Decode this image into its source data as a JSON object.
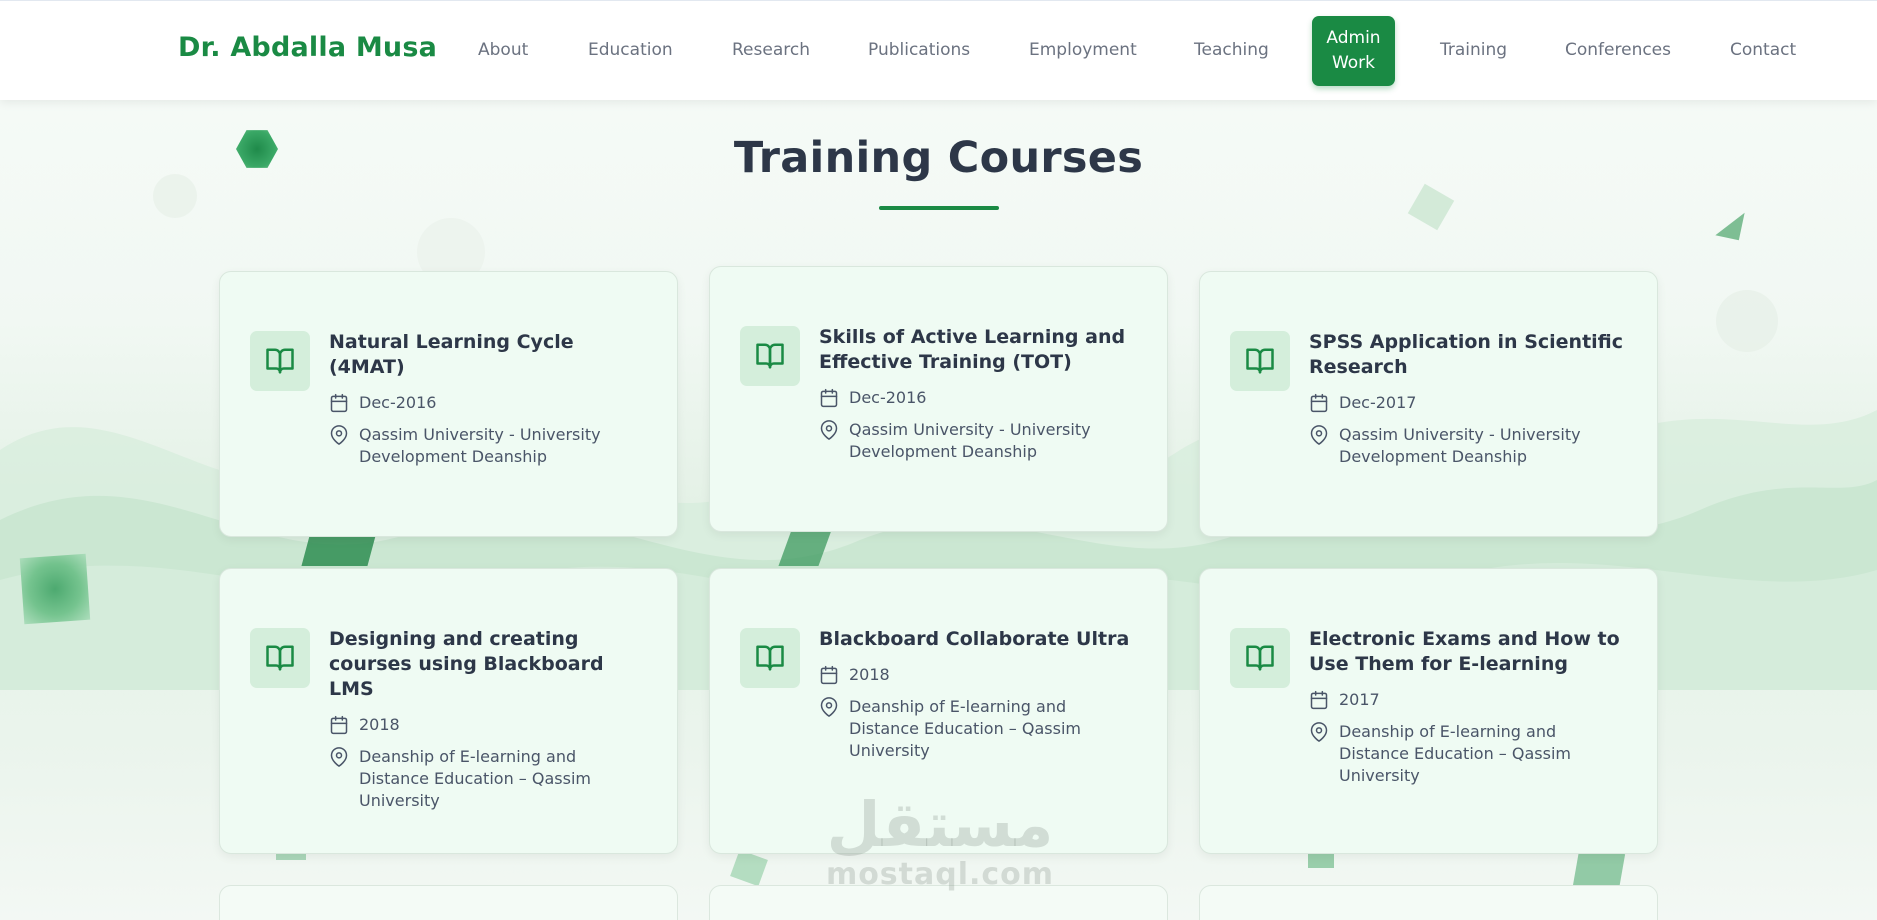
{
  "nav": {
    "brand": "Dr. Abdalla Musa",
    "links": [
      {
        "label": "About"
      },
      {
        "label": "Education"
      },
      {
        "label": "Research"
      },
      {
        "label": "Publications"
      },
      {
        "label": "Employment"
      },
      {
        "label": "Teaching"
      },
      {
        "label": "Admin Work",
        "line1": "Admin",
        "line2": "Work",
        "active": true
      },
      {
        "label": "Training"
      },
      {
        "label": "Conferences"
      },
      {
        "label": "Contact"
      }
    ]
  },
  "section": {
    "title": "Training Courses"
  },
  "courses": [
    {
      "title": "Natural Learning Cycle (4MAT)",
      "date": "Dec-2016",
      "location": "Qassim University - University Development Deanship"
    },
    {
      "title": "Skills of Active Learning and Effective Training (TOT)",
      "date": "Dec-2016",
      "location": "Qassim University - University Development Deanship"
    },
    {
      "title": "SPSS Application in Scientific Research",
      "date": "Dec-2017",
      "location": "Qassim University - University Development Deanship"
    },
    {
      "title": "Designing and creating courses using Blackboard LMS",
      "date": "2018",
      "location": "Deanship of E-learning and Distance Education – Qassim University"
    },
    {
      "title": "Blackboard Collaborate Ultra",
      "date": "2018",
      "location": "Deanship of E-learning and Distance Education – Qassim University"
    },
    {
      "title": "Electronic Exams and How to Use Them for E-learning",
      "date": "2017",
      "location": "Deanship of E-learning and Distance Education – Qassim University"
    }
  ],
  "icons": {
    "course": "book-open-icon",
    "date": "calendar-icon",
    "location": "map-pin-icon"
  },
  "watermark": {
    "arabic": "مستقل",
    "latin": "mostaql.com"
  },
  "colors": {
    "accent": "#1a8a44",
    "card_bg": "#effbf3",
    "icon_bg": "#d4eedb",
    "title_text": "#2d3748"
  }
}
